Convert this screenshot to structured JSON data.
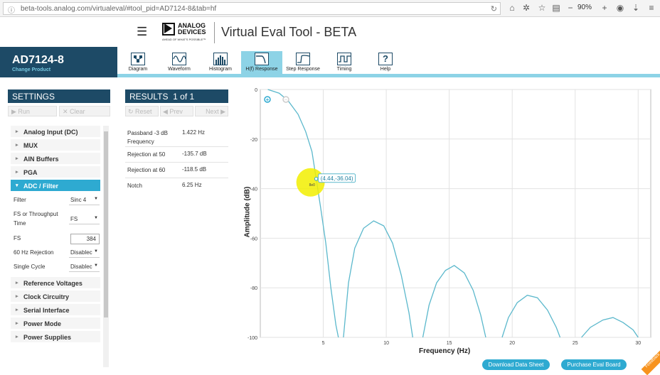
{
  "browser": {
    "url": "beta-tools.analog.com/virtualeval/#tool_pid=AD7124-8&tab=hf",
    "zoom": "90%"
  },
  "header": {
    "logo_line1": "ANALOG",
    "logo_line2": "DEVICES",
    "logo_tagline": "AHEAD OF WHAT'S POSSIBLE™",
    "title": "Virtual Eval Tool - BETA"
  },
  "product": {
    "name": "AD7124-8",
    "change_label": "Change Product"
  },
  "nav_tabs": [
    {
      "label": "Diagram"
    },
    {
      "label": "Waveform"
    },
    {
      "label": "Histogram"
    },
    {
      "label": "H(f) Response"
    },
    {
      "label": "Step Response"
    },
    {
      "label": "Timing"
    },
    {
      "label": "Help"
    }
  ],
  "settings": {
    "title": "SETTINGS",
    "run_label": "Run",
    "clear_label": "Clear",
    "menu_top": [
      {
        "label": "Analog Input (DC)"
      },
      {
        "label": "MUX"
      },
      {
        "label": "AIN Buffers"
      },
      {
        "label": "PGA"
      },
      {
        "label": "ADC / Filter"
      }
    ],
    "adc_filter": {
      "filter_label": "Filter",
      "filter_value": "Sinc 4",
      "fs_throughput_label": "FS or Throughput Time",
      "fs_throughput_value": "FS",
      "fs_label": "FS",
      "fs_value": "384",
      "hz60_label": "60 Hz Rejection",
      "hz60_value": "Disablec",
      "single_cycle_label": "Single Cycle",
      "single_cycle_value": "Disablec"
    },
    "menu_bottom": [
      {
        "label": "Reference Voltages"
      },
      {
        "label": "Clock Circuitry"
      },
      {
        "label": "Serial Interface"
      },
      {
        "label": "Power Mode"
      },
      {
        "label": "Power Supplies"
      }
    ]
  },
  "results": {
    "title": "RESULTS",
    "count": "1 of 1",
    "reset_label": "Reset",
    "prev_label": "Prev",
    "next_label": "Next",
    "rows": [
      {
        "key": "Passband -3 dB Frequency",
        "value": "1.422 Hz"
      },
      {
        "key": "Rejection at 50",
        "value": "-135.7 dB"
      },
      {
        "key": "Rejection at 60",
        "value": "-118.5 dB"
      },
      {
        "key": "Notch",
        "value": "6.25 Hz"
      }
    ]
  },
  "chart_data": {
    "type": "line",
    "xlabel": "Frequency (Hz)",
    "ylabel": "Amplitude (dB)",
    "xlim": [
      0,
      31
    ],
    "ylim": [
      -100,
      0
    ],
    "xticks": [
      5,
      10,
      15,
      20,
      25,
      30
    ],
    "yticks": [
      0,
      -20,
      -40,
      -60,
      -80,
      -100
    ],
    "grid": true,
    "tooltip": "(4.44,-36.04)",
    "cursor_label": "8e0",
    "series": [
      {
        "color": "#5bb8cc",
        "segments": [
          [
            [
              0.6,
              0
            ],
            [
              1.5,
              -1.5
            ],
            [
              2.2,
              -4.5
            ],
            [
              3.0,
              -10
            ],
            [
              3.6,
              -17
            ],
            [
              4.1,
              -25
            ],
            [
              4.44,
              -36.04
            ],
            [
              4.8,
              -48
            ],
            [
              5.2,
              -62
            ],
            [
              5.6,
              -80
            ],
            [
              6.0,
              -95
            ],
            [
              6.2,
              -100
            ]
          ],
          [
            [
              6.6,
              -100
            ],
            [
              7.0,
              -78
            ],
            [
              7.5,
              -64
            ],
            [
              8.2,
              -56
            ],
            [
              9.0,
              -53
            ],
            [
              9.8,
              -55
            ],
            [
              10.5,
              -62
            ],
            [
              11.2,
              -75
            ],
            [
              11.8,
              -90
            ],
            [
              12.1,
              -100
            ]
          ],
          [
            [
              12.9,
              -100
            ],
            [
              13.4,
              -87
            ],
            [
              14.0,
              -78
            ],
            [
              14.7,
              -73
            ],
            [
              15.4,
              -71
            ],
            [
              16.2,
              -74
            ],
            [
              16.9,
              -81
            ],
            [
              17.5,
              -91
            ],
            [
              17.9,
              -100
            ]
          ],
          [
            [
              19.2,
              -100
            ],
            [
              19.7,
              -92
            ],
            [
              20.4,
              -86
            ],
            [
              21.2,
              -83
            ],
            [
              22.0,
              -84
            ],
            [
              22.8,
              -89
            ],
            [
              23.5,
              -96
            ],
            [
              23.8,
              -100
            ]
          ],
          [
            [
              25.5,
              -100
            ],
            [
              26.2,
              -96
            ],
            [
              27.2,
              -93
            ],
            [
              28.0,
              -92
            ],
            [
              28.8,
              -94
            ],
            [
              29.6,
              -97
            ],
            [
              30.0,
              -100
            ]
          ]
        ]
      }
    ]
  },
  "actions": {
    "datasheet_label": "Download Data Sheet",
    "eval_board_label": "Purchase Eval Board",
    "feedback_label": "Feedback"
  },
  "colors": {
    "navy": "#1d4a66",
    "accent": "#2eaad1",
    "tab_active": "#8dd3e6",
    "highlight": "#f2ee00"
  }
}
